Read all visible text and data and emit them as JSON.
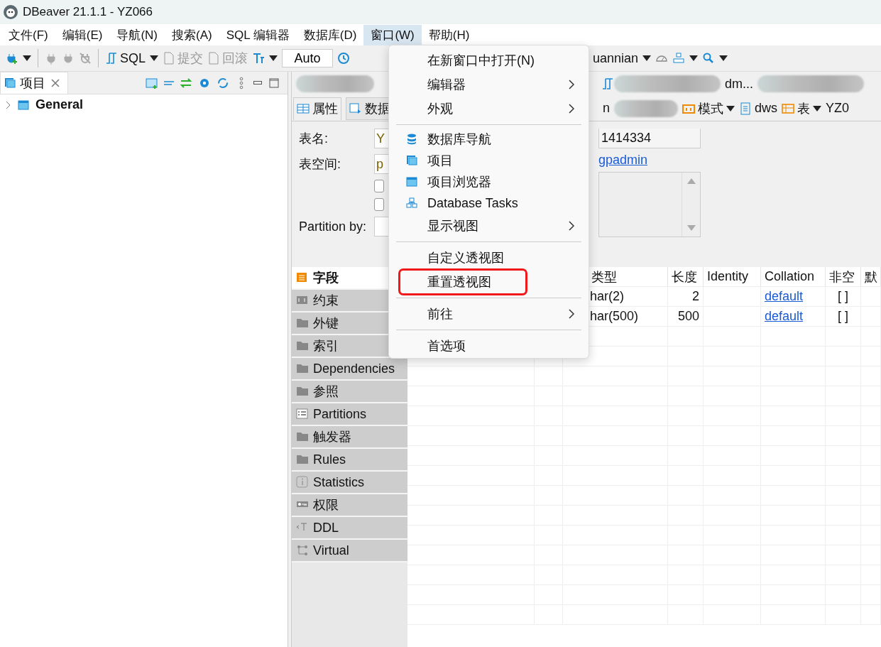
{
  "window": {
    "title": "DBeaver 21.1.1 - YZ066"
  },
  "menu_bar": [
    {
      "label": "文件(F)",
      "selected": false
    },
    {
      "label": "编辑(E)",
      "selected": false
    },
    {
      "label": "导航(N)",
      "selected": false
    },
    {
      "label": "搜索(A)",
      "selected": false
    },
    {
      "label": "SQL 编辑器",
      "selected": false
    },
    {
      "label": "数据库(D)",
      "selected": false
    },
    {
      "label": "窗口(W)",
      "selected": true
    },
    {
      "label": "帮助(H)",
      "selected": false
    }
  ],
  "toolbar": {
    "sql": "SQL",
    "commit": {
      "label": "提交",
      "disabled": true
    },
    "rollback": {
      "label": "回滚",
      "disabled": true
    },
    "mode": "Auto",
    "connection": "uannian"
  },
  "project_panel": {
    "tab": {
      "label": "项目",
      "selected": true
    },
    "tree": [
      {
        "label": "General",
        "expanded": false
      }
    ]
  },
  "editor": {
    "tabs": [
      {
        "label": "dm...",
        "selected": false
      }
    ],
    "subtabs": [
      {
        "label": "属性",
        "selected": true
      },
      {
        "label": "数据",
        "selected": false
      }
    ],
    "breadcrumbs": [
      {
        "label": "n",
        "dropdown": false
      },
      {
        "label": "模式",
        "dropdown": true
      },
      {
        "label": "dws",
        "dropdown": false
      },
      {
        "label": "表",
        "dropdown": true
      },
      {
        "label": "YZ0",
        "dropdown": false
      }
    ],
    "form": {
      "fields": [
        {
          "label": "表名:",
          "value": "Y"
        },
        {
          "label": "表空间:",
          "value": "p"
        }
      ],
      "checkboxes": [
        {
          "checked": false
        },
        {
          "checked": false
        }
      ],
      "partition_label": "Partition by:",
      "oid": "1414334",
      "owner": "gpadmin"
    },
    "sections": [
      {
        "label": "字段",
        "selected": true
      },
      {
        "label": "约束",
        "selected": false
      },
      {
        "label": "外键",
        "selected": false
      },
      {
        "label": "索引",
        "selected": false
      },
      {
        "label": "Dependencies",
        "selected": false
      },
      {
        "label": "参照",
        "selected": false
      },
      {
        "label": "Partitions",
        "selected": false
      },
      {
        "label": "触发器",
        "selected": false
      },
      {
        "label": "Rules",
        "selected": false
      },
      {
        "label": "Statistics",
        "selected": false
      },
      {
        "label": "权限",
        "selected": false
      },
      {
        "label": "DDL",
        "selected": false
      },
      {
        "label": "Virtual",
        "selected": false
      }
    ],
    "table": {
      "columns": [
        "类型",
        "长度",
        "Identity",
        "Collation",
        "非空",
        "默"
      ],
      "rows": [
        {
          "type": "har(2)",
          "length": "2",
          "collation": "default",
          "not_null": "[ ]"
        },
        {
          "type": "har(500)",
          "length": "500",
          "collation": "default",
          "not_null": "[ ]"
        }
      ]
    }
  },
  "window_menu": [
    {
      "kind": "item",
      "label": "在新窗口中打开(N)",
      "submenu": false,
      "annotated": false
    },
    {
      "kind": "item",
      "label": "编辑器",
      "submenu": true,
      "annotated": false
    },
    {
      "kind": "item",
      "label": "外观",
      "submenu": true,
      "annotated": false
    },
    {
      "kind": "separator"
    },
    {
      "kind": "view",
      "label": "数据库导航",
      "submenu": false,
      "annotated": false
    },
    {
      "kind": "view",
      "label": "项目",
      "submenu": false,
      "annotated": false
    },
    {
      "kind": "view",
      "label": "项目浏览器",
      "submenu": false,
      "annotated": false
    },
    {
      "kind": "view",
      "label": "Database Tasks",
      "submenu": false,
      "annotated": false
    },
    {
      "kind": "item",
      "label": "显示视图",
      "submenu": true,
      "annotated": false
    },
    {
      "kind": "separator"
    },
    {
      "kind": "item",
      "label": "自定义透视图",
      "submenu": false,
      "annotated": false
    },
    {
      "kind": "item",
      "label": "重置透视图",
      "submenu": false,
      "annotated": true
    },
    {
      "kind": "separator"
    },
    {
      "kind": "item",
      "label": "前往",
      "submenu": true,
      "annotated": false
    },
    {
      "kind": "separator"
    },
    {
      "kind": "item",
      "label": "首选项",
      "submenu": false,
      "annotated": false
    }
  ]
}
